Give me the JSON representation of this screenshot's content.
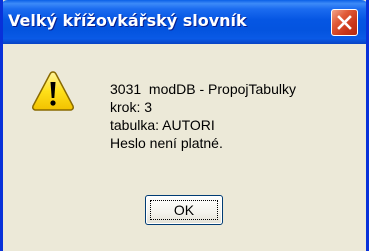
{
  "window": {
    "title": "Velký křížovkářský slovník",
    "close_icon": "close-icon",
    "title_color": "#0454DF",
    "close_color": "#E05A37"
  },
  "message": {
    "icon": "warning-icon",
    "lines": [
      "3031  modDB - PropojTabulky",
      "krok: 3",
      "tabulka: AUTORI",
      "Heslo není platné."
    ]
  },
  "buttons": {
    "ok_label": "OK"
  }
}
